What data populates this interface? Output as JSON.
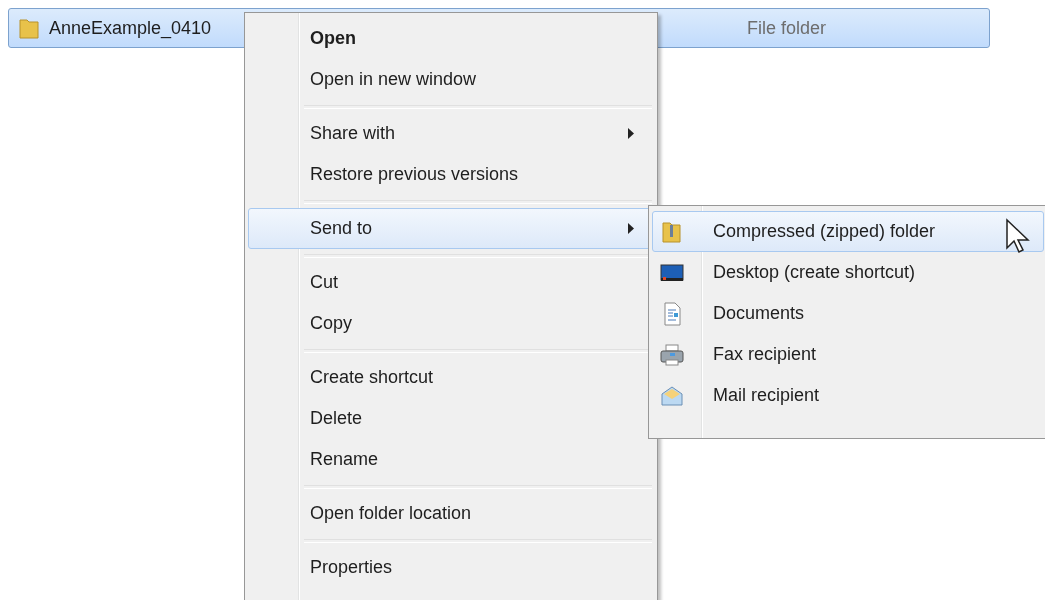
{
  "file_row": {
    "name": "AnneExample_0410",
    "type": "File folder",
    "selected": true
  },
  "menu": {
    "groups": [
      [
        {
          "label": "Open",
          "default": true,
          "submenu": false,
          "selected": false
        },
        {
          "label": "Open in new window",
          "default": false,
          "submenu": false,
          "selected": false
        }
      ],
      [
        {
          "label": "Share with",
          "default": false,
          "submenu": true,
          "selected": false
        },
        {
          "label": "Restore previous versions",
          "default": false,
          "submenu": false,
          "selected": false
        }
      ],
      [
        {
          "label": "Send to",
          "default": false,
          "submenu": true,
          "selected": true
        }
      ],
      [
        {
          "label": "Cut",
          "default": false,
          "submenu": false,
          "selected": false
        },
        {
          "label": "Copy",
          "default": false,
          "submenu": false,
          "selected": false
        }
      ],
      [
        {
          "label": "Create shortcut",
          "default": false,
          "submenu": false,
          "selected": false
        },
        {
          "label": "Delete",
          "default": false,
          "submenu": false,
          "selected": false
        },
        {
          "label": "Rename",
          "default": false,
          "submenu": false,
          "selected": false
        }
      ],
      [
        {
          "label": "Open folder location",
          "default": false,
          "submenu": false,
          "selected": false
        }
      ],
      [
        {
          "label": "Properties",
          "default": false,
          "submenu": false,
          "selected": false
        }
      ]
    ]
  },
  "submenu": {
    "items": [
      {
        "kind": "zip",
        "label": "Compressed (zipped) folder",
        "selected": true
      },
      {
        "kind": "desktop",
        "label": "Desktop (create shortcut)",
        "selected": false
      },
      {
        "kind": "documents",
        "label": "Documents",
        "selected": false
      },
      {
        "kind": "fax",
        "label": "Fax recipient",
        "selected": false
      },
      {
        "kind": "mail",
        "label": "Mail recipient",
        "selected": false
      }
    ]
  }
}
